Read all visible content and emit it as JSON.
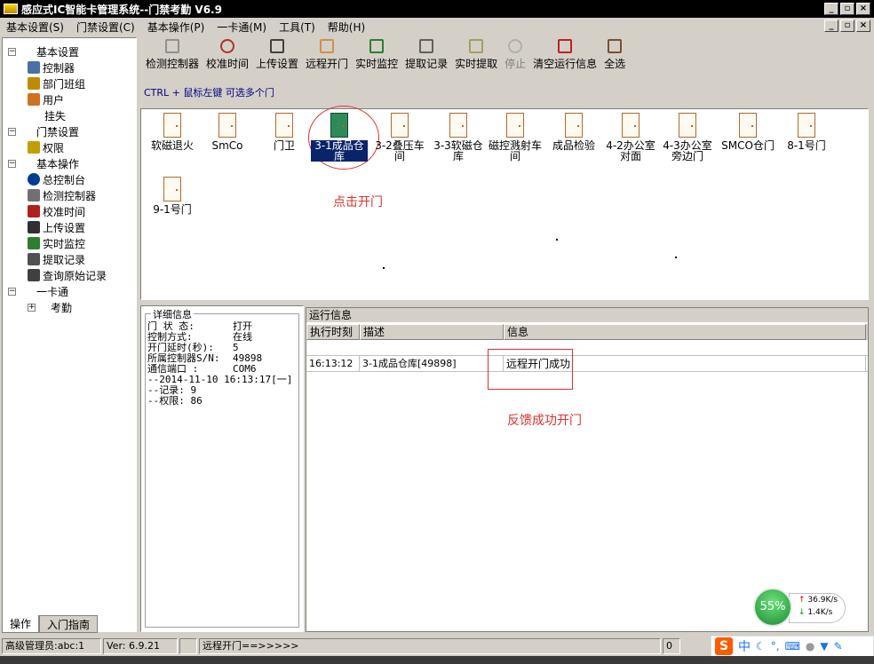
{
  "window": {
    "title": "感应式IC智能卡管理系统--门禁考勤 V6.9"
  },
  "menu": [
    "基本设置(S)",
    "门禁设置(C)",
    "基本操作(P)",
    "一卡通(M)",
    "工具(T)",
    "帮助(H)"
  ],
  "tree": [
    {
      "label": "基本设置",
      "level": 0,
      "exp": "−"
    },
    {
      "label": "控制器",
      "level": 1,
      "icon": "controller-icon"
    },
    {
      "label": "部门班组",
      "level": 1,
      "icon": "department-icon"
    },
    {
      "label": "用户",
      "level": 1,
      "icon": "user-icon"
    },
    {
      "label": "挂失",
      "level": 1,
      "icon": ""
    },
    {
      "label": "门禁设置",
      "level": 0,
      "exp": "−"
    },
    {
      "label": "权限",
      "level": 1,
      "icon": "key-icon"
    },
    {
      "label": "基本操作",
      "level": 0,
      "exp": "−"
    },
    {
      "label": "总控制台",
      "level": 1,
      "icon": "info-icon"
    },
    {
      "label": "检测控制器",
      "level": 1,
      "icon": "wrench-icon"
    },
    {
      "label": "校准时间",
      "level": 1,
      "icon": "clock-icon"
    },
    {
      "label": "上传设置",
      "level": 1,
      "icon": "upload-icon"
    },
    {
      "label": "实时监控",
      "level": 1,
      "icon": "monitor-icon"
    },
    {
      "label": "提取记录",
      "level": 1,
      "icon": "records-icon"
    },
    {
      "label": "查询原始记录",
      "level": 1,
      "icon": "query-icon"
    },
    {
      "label": "一卡通",
      "level": 0,
      "exp": "−"
    },
    {
      "label": "考勤",
      "level": 1,
      "exp": "+"
    }
  ],
  "left_tabs": [
    "操作",
    "入门指南"
  ],
  "toolbar": [
    {
      "label": "检测控制器",
      "icon": "wrench-icon",
      "disabled": false
    },
    {
      "label": "校准时间",
      "icon": "clock-icon",
      "disabled": false
    },
    {
      "label": "上传设置",
      "icon": "upload-icon",
      "disabled": false
    },
    {
      "label": "远程开门",
      "icon": "door-open-icon",
      "disabled": false
    },
    {
      "label": "实时监控",
      "icon": "monitor-icon",
      "disabled": false
    },
    {
      "label": "提取记录",
      "icon": "records-icon",
      "disabled": false
    },
    {
      "label": "实时提取",
      "icon": "realtime-extract-icon",
      "disabled": false
    },
    {
      "label": "停止",
      "icon": "stop-icon",
      "disabled": true
    },
    {
      "label": "清空运行信息",
      "icon": "clear-icon",
      "disabled": false
    },
    {
      "label": "全选",
      "icon": "select-all-icon",
      "disabled": false
    }
  ],
  "hint": "CTRL + 鼠标左键 可选多个门",
  "doors": [
    {
      "label": "软磁退火",
      "open": false,
      "selected": false
    },
    {
      "label": "SmCo",
      "open": false,
      "selected": false
    },
    {
      "label": "门卫",
      "open": false,
      "selected": false
    },
    {
      "label": "3-1成品仓库",
      "open": true,
      "selected": true
    },
    {
      "label": "3-2叠压车间",
      "open": false,
      "selected": false
    },
    {
      "label": "3-3软磁仓库",
      "open": false,
      "selected": false
    },
    {
      "label": "磁控溅射车间",
      "open": false,
      "selected": false
    },
    {
      "label": "成品检验",
      "open": false,
      "selected": false
    },
    {
      "label": "4-2办公室对面",
      "open": false,
      "selected": false
    },
    {
      "label": "4-3办公室旁边门",
      "open": false,
      "selected": false
    },
    {
      "label": "SMCO仓门",
      "open": false,
      "selected": false
    },
    {
      "label": "8-1号门",
      "open": false,
      "selected": false
    },
    {
      "label": "9-1号门",
      "open": false,
      "selected": false
    }
  ],
  "annotations": {
    "click_open": "点击开门",
    "feedback": "反馈成功开门"
  },
  "detail": {
    "title": "详细信息",
    "rows": [
      {
        "k": "门 状 态:",
        "v": "打开"
      },
      {
        "k": "控制方式:",
        "v": "在线"
      },
      {
        "k": "开门延时(秒):",
        "v": "5"
      },
      {
        "k": "所属控制器S/N:",
        "v": "49898"
      },
      {
        "k": "通信端口 :",
        "v": "COM6"
      },
      {
        "k": "--2014-11-10 16:13:17[一]",
        "v": ""
      },
      {
        "k": "--记录: 9",
        "v": ""
      },
      {
        "k": "--权限: 86",
        "v": ""
      }
    ]
  },
  "run": {
    "title": "运行信息",
    "columns": [
      "执行时刻",
      "描述",
      "信息"
    ],
    "rows": [
      {
        "time": "16:13:12",
        "desc": "3-1成品仓库[49898]",
        "info": "远程开门成功"
      }
    ]
  },
  "status": {
    "user": "高级管理员:abc:1",
    "version": "Ver: 6.9.21",
    "action": "远程开门==>>>>>",
    "count": "0"
  },
  "net": {
    "percent": "55%",
    "up": "36.9K/s",
    "down": "1.4K/s"
  },
  "ime": {
    "s": "S",
    "lang": "中"
  }
}
